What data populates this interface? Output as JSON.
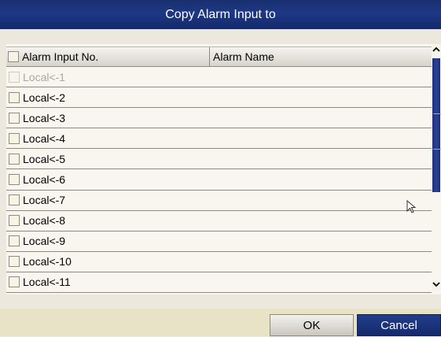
{
  "dialog": {
    "title": "Copy Alarm Input to"
  },
  "table": {
    "columns": [
      "Alarm Input No.",
      "Alarm Name"
    ],
    "rows": [
      {
        "no": "Local<-1",
        "name": "",
        "checked": false,
        "disabled": true
      },
      {
        "no": "Local<-2",
        "name": "",
        "checked": false,
        "disabled": false
      },
      {
        "no": "Local<-3",
        "name": "",
        "checked": false,
        "disabled": false
      },
      {
        "no": "Local<-4",
        "name": "",
        "checked": false,
        "disabled": false
      },
      {
        "no": "Local<-5",
        "name": "",
        "checked": false,
        "disabled": false
      },
      {
        "no": "Local<-6",
        "name": "",
        "checked": false,
        "disabled": false
      },
      {
        "no": "Local<-7",
        "name": "",
        "checked": false,
        "disabled": false
      },
      {
        "no": "Local<-8",
        "name": "",
        "checked": false,
        "disabled": false
      },
      {
        "no": "Local<-9",
        "name": "",
        "checked": false,
        "disabled": false
      },
      {
        "no": "Local<-10",
        "name": "",
        "checked": false,
        "disabled": false
      },
      {
        "no": "Local<-11",
        "name": "",
        "checked": false,
        "disabled": false
      }
    ]
  },
  "buttons": {
    "ok": "OK",
    "cancel": "Cancel"
  },
  "colors": {
    "title_bar": "#1e3886",
    "cancel_button": "#1a3079",
    "background": "#ece8de"
  },
  "icons": {
    "scroll_up": "chevron-up-icon",
    "scroll_down": "chevron-down-icon",
    "cursor": "mouse-pointer-icon"
  }
}
